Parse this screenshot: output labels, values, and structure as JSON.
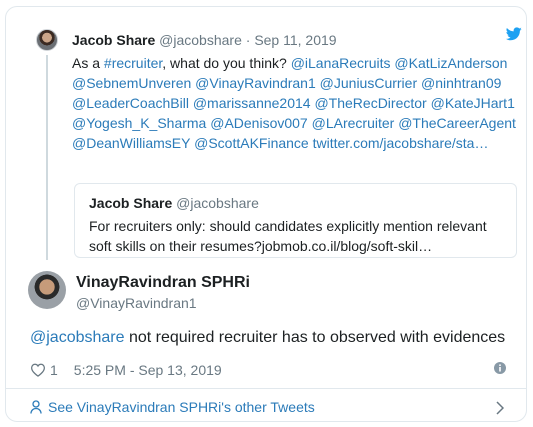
{
  "parent_tweet": {
    "author_name": "Jacob Share",
    "author_handle": "@jacobshare",
    "separator": "·",
    "date": "Sep 11, 2019",
    "text_prefix": "As a ",
    "hashtag": "#recruiter",
    "text_after_hashtag": ", what do you think? ",
    "mentions": [
      "@iLanaRecruits",
      "@KatLizAnderson",
      "@SebnemUnveren",
      "@VinayRavindran1",
      "@JuniusCurrier",
      "@ninhtran09",
      "@LeaderCoachBill",
      "@marissanne2014",
      "@TheRecDirector",
      "@KateJHart1",
      "@Yogesh_K_Sharma",
      "@ADenisov007",
      "@LArecruiter",
      "@TheCareerAgent",
      "@DeanWilliamsEY",
      "@ScottAKFinance"
    ],
    "link": "twitter.com/jacobshare/sta…",
    "bird_icon": "twitter-bird-icon",
    "accent_color": "#1da1f2"
  },
  "quoted_tweet": {
    "author_name": "Jacob Share",
    "author_handle": "@jacobshare",
    "text": "For recruiters only: should candidates explicitly mention relevant soft skills on their resumes?jobmob.co.il/blog/soft-skil…"
  },
  "reply_tweet": {
    "author_name": "VinayRavindran SPHRi",
    "author_handle": "@VinayRavindran1",
    "mention": "@jacobshare",
    "text": " not required recruiter has to observed with evidences",
    "like_count": "1",
    "timestamp": "5:25 PM - Sep 13, 2019"
  },
  "footer": {
    "see_more_label": "See VinayRavindran SPHRi's other Tweets"
  },
  "colors": {
    "link": "#2b7bb9",
    "muted": "#697882",
    "border": "#e1e8ed"
  }
}
